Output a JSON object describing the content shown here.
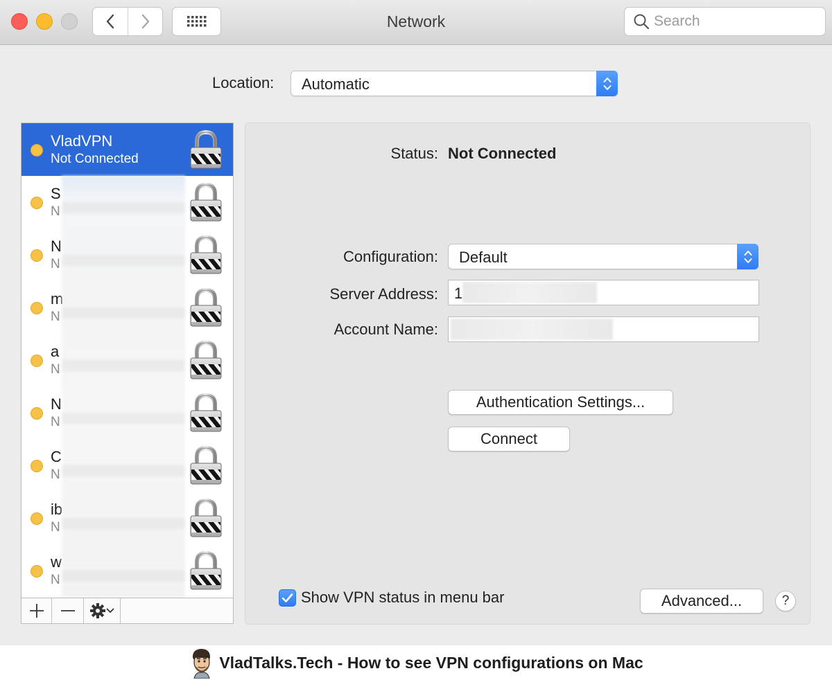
{
  "window": {
    "title": "Network",
    "search_placeholder": "Search"
  },
  "location": {
    "label": "Location:",
    "value": "Automatic"
  },
  "services": [
    {
      "name": "VladVPN",
      "status": "Not Connected",
      "selected": true
    },
    {
      "name": "S",
      "status": "N"
    },
    {
      "name": "N",
      "status": "N"
    },
    {
      "name": "m",
      "status": "N"
    },
    {
      "name": "a",
      "status": "N"
    },
    {
      "name": "N",
      "status": "N"
    },
    {
      "name": "C",
      "status": "N"
    },
    {
      "name": "ib",
      "status": "N"
    },
    {
      "name": "w",
      "status": "N"
    }
  ],
  "sidebar_toolbar": {
    "add": "+",
    "remove": "—"
  },
  "detail": {
    "status_label": "Status:",
    "status_value": "Not Connected",
    "configuration_label": "Configuration:",
    "configuration_value": "Default",
    "server_label": "Server Address:",
    "server_value": "1",
    "account_label": "Account Name:",
    "account_value": "",
    "auth_button": "Authentication Settings...",
    "connect_button": "Connect",
    "show_status_label": "Show VPN status in menu bar",
    "show_status_checked": true,
    "advanced_button": "Advanced...",
    "help_button": "?"
  },
  "caption": {
    "text": "VladTalks.Tech - How to see VPN configurations on Mac"
  },
  "colors": {
    "selection": "#2b68d8",
    "accent": "#2e7cf6",
    "status_dot": "#f5c148"
  }
}
